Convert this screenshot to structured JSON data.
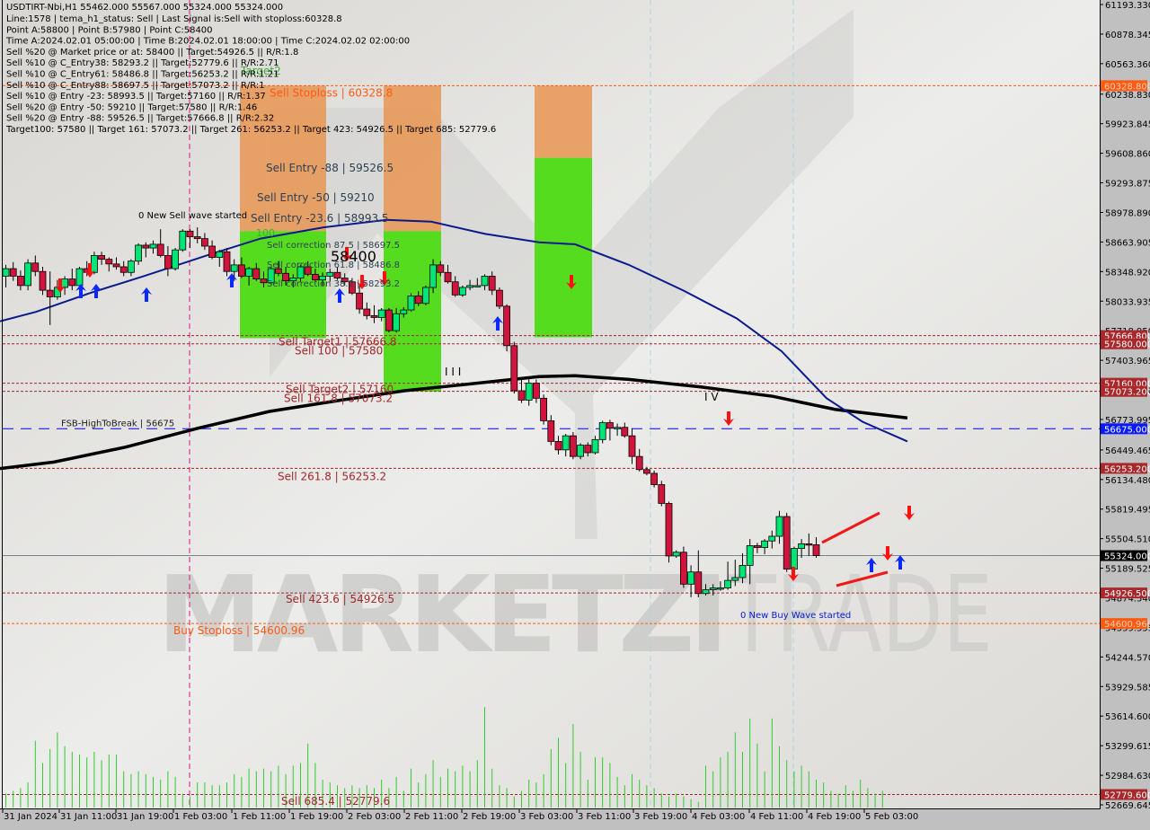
{
  "header": {
    "symbol_line": "USDTIRT-Nbi,H1  55462.000 55567.000 55324.000 55324.000",
    "info_lines": [
      "Line:1578 | tema_h1_status: Sell | Last Signal is:Sell with stoploss:60328.8",
      "Point A:58800 | Point B:57980 | Point C:58400",
      "Time A:2024.02.01 05:00:00 | Time B:2024.02.01 18:00:00 | Time C:2024.02.02 02:00:00",
      "Sell %20 @ Market price or at: 58400 || Target:54926.5 || R/R:1.8",
      "Sell %10 @ C_Entry38: 58293.2 || Target:52779.6 || R/R:2.71",
      "Sell %10 @ C_Entry61: 58486.8 || Target:56253.2 || R/R:1.21",
      "Sell %10 @ C_Entry88: 58697.5 || Target:57073.2 || R/R:1",
      "Sell %10 @ Entry -23: 58993.5 || Target:57160 || R/R:1.37",
      "Sell %20 @ Entry -50: 59210 || Target:57580 || R/R:1.46",
      "Sell %20 @ Entry -88: 59526.5 || Target:57666.8 || R/R:2.32",
      "Target100: 57580 || Target 161: 57073.2 || Target 261: 56253.2 || Target 423: 54926.5 || Target 685: 52779.6"
    ]
  },
  "watermark": {
    "left": "MARKETZI",
    "right": "TRADE"
  },
  "colors": {
    "background": "#e4e4e2",
    "axis_bg": "#c0c0c0",
    "bull": "#00e676",
    "bear": "#d0143c",
    "green_zone": "#56dc1e",
    "orange_zone": "#e89a5a",
    "level_red": "#a0282c",
    "level_orange": "#ff5a14",
    "level_blue": "#0000ff",
    "ma_fast": "#0a1a8c",
    "ma_slow": "#000000",
    "volume": "#2ecc2e"
  },
  "chart_data": {
    "type": "candlestick",
    "title": "USDTIRT-Nbi,H1",
    "ylim": [
      52669.645,
      61193.33
    ],
    "y_ticks": [
      61193.33,
      60878.345,
      60563.36,
      60238.83,
      59923.845,
      59608.86,
      59293.875,
      58978.89,
      58663.905,
      58348.92,
      58033.935,
      57718.95,
      57403.965,
      57088.98,
      56773.995,
      56449.465,
      56134.48,
      55819.495,
      55504.51,
      55189.525,
      54874.54,
      54559.555,
      54244.57,
      53929.585,
      53614.6,
      53299.615,
      52984.63,
      52669.645
    ],
    "x_ticks": [
      "31 Jan 2024",
      "31 Jan 11:00",
      "31 Jan 19:00",
      "1 Feb 03:00",
      "1 Feb 11:00",
      "1 Feb 19:00",
      "2 Feb 03:00",
      "2 Feb 11:00",
      "2 Feb 19:00",
      "3 Feb 03:00",
      "3 Feb 11:00",
      "3 Feb 19:00",
      "4 Feb 03:00",
      "4 Feb 11:00",
      "4 Feb 19:00",
      "5 Feb 03:00"
    ],
    "last_price": 55324.0,
    "price_labels": [
      {
        "value": 60328.8,
        "text": "60328.800",
        "kind": "orange"
      },
      {
        "value": 57666.8,
        "text": "57666.800",
        "kind": "red"
      },
      {
        "value": 57580.0,
        "text": "57580.000",
        "kind": "red"
      },
      {
        "value": 57160.0,
        "text": "57160.000",
        "kind": "red"
      },
      {
        "value": 57073.2,
        "text": "57073.200",
        "kind": "red"
      },
      {
        "value": 56675.0,
        "text": "56675.000",
        "kind": "blue"
      },
      {
        "value": 56253.2,
        "text": "56253.200",
        "kind": "red"
      },
      {
        "value": 55324.0,
        "text": "55324.000",
        "kind": "black"
      },
      {
        "value": 54926.5,
        "text": "54926.500",
        "kind": "red"
      },
      {
        "value": 54600.96,
        "text": "54600.960",
        "kind": "orange"
      },
      {
        "value": 52779.6,
        "text": "52779.600",
        "kind": "red"
      }
    ],
    "levels": [
      {
        "value": 60328.8,
        "label": "Sell Stoploss | 60328.8",
        "kind": "orange"
      },
      {
        "value": 57666.8,
        "label": "Sell Target1 | 57666.8",
        "kind": "red"
      },
      {
        "value": 57580.0,
        "label": "Sell 100 | 57580",
        "kind": "red"
      },
      {
        "value": 57160.0,
        "label": "Sell Target2 | 57160",
        "kind": "red"
      },
      {
        "value": 57073.2,
        "label": "Sell 161.8 | 57073.2",
        "kind": "red"
      },
      {
        "value": 56675.0,
        "label": "FSB-HighToBreak | 56675",
        "kind": "blue"
      },
      {
        "value": 56253.2,
        "label": "Sell  261.8 | 56253.2",
        "kind": "red"
      },
      {
        "value": 54926.5,
        "label": "Sell  423.6 | 54926.5",
        "kind": "red"
      },
      {
        "value": 54600.96,
        "label": "Buy Stoploss | 54600.96",
        "kind": "orange"
      },
      {
        "value": 52779.6,
        "label": "Sell  685.4 | 52779.6",
        "kind": "red"
      }
    ],
    "zone_labels": [
      {
        "value": 59526.5,
        "text": "Sell Entry -88 | 59526.5"
      },
      {
        "value": 59210,
        "text": "Sell Entry -50 | 59210"
      },
      {
        "value": 58993.5,
        "text": "Sell Entry -23.6 | 58993.5"
      },
      {
        "value": 58697.5,
        "text": "Sell correction 87.5 | 58697.5"
      },
      {
        "value": 58486.8,
        "text": "Sell correction 61.8 | 58486.8"
      },
      {
        "value": 58293.2,
        "text": "Sell correction 38.2 | 58293.2"
      }
    ],
    "annotations": [
      {
        "text": "0 New Sell wave started",
        "value": 58900
      },
      {
        "text": "0 New Buy Wave started",
        "value": 54700
      },
      {
        "text": "Target2",
        "value": 60470
      },
      {
        "text": "58400",
        "value": 58430
      },
      {
        "text": "I V",
        "value": 57040
      },
      {
        "text": "I I I",
        "value": 57520
      },
      {
        "text": "100",
        "value": 58780
      }
    ],
    "candles": [
      [
        58300,
        58420,
        58180,
        58380
      ],
      [
        58380,
        58450,
        58250,
        58300
      ],
      [
        58300,
        58360,
        58150,
        58200
      ],
      [
        58200,
        58480,
        58150,
        58440
      ],
      [
        58440,
        58520,
        58300,
        58350
      ],
      [
        58350,
        58400,
        58100,
        58150
      ],
      [
        58150,
        58350,
        57780,
        58080
      ],
      [
        58080,
        58260,
        58050,
        58180
      ],
      [
        58180,
        58300,
        58100,
        58270
      ],
      [
        58270,
        58380,
        58150,
        58200
      ],
      [
        58200,
        58400,
        58180,
        58380
      ],
      [
        58380,
        58460,
        58300,
        58340
      ],
      [
        58340,
        58560,
        58320,
        58520
      ],
      [
        58520,
        58560,
        58420,
        58480
      ],
      [
        58480,
        58500,
        58350,
        58430
      ],
      [
        58430,
        58500,
        58370,
        58400
      ],
      [
        58400,
        58460,
        58300,
        58340
      ],
      [
        58340,
        58480,
        58300,
        58460
      ],
      [
        58460,
        58650,
        58420,
        58630
      ],
      [
        58630,
        58660,
        58500,
        58600
      ],
      [
        58600,
        58680,
        58540,
        58640
      ],
      [
        58640,
        58800,
        58500,
        58520
      ],
      [
        58520,
        58620,
        58300,
        58380
      ],
      [
        58380,
        58600,
        58360,
        58580
      ],
      [
        58580,
        58800,
        58560,
        58780
      ],
      [
        58780,
        58800,
        58600,
        58720
      ],
      [
        58720,
        58820,
        58650,
        58700
      ],
      [
        58700,
        58760,
        58580,
        58620
      ],
      [
        58620,
        58680,
        58480,
        58500
      ],
      [
        58500,
        58580,
        58400,
        58560
      ],
      [
        58560,
        58600,
        58300,
        58350
      ],
      [
        58350,
        58480,
        58250,
        58420
      ],
      [
        58420,
        58500,
        58280,
        58300
      ],
      [
        58300,
        58400,
        58200,
        58380
      ],
      [
        58380,
        58440,
        58250,
        58270
      ],
      [
        58270,
        58350,
        58180,
        58230
      ],
      [
        58230,
        58400,
        58220,
        58380
      ],
      [
        58380,
        58460,
        58300,
        58330
      ],
      [
        58330,
        58400,
        58200,
        58250
      ],
      [
        58250,
        58320,
        58180,
        58280
      ],
      [
        58280,
        58420,
        58240,
        58400
      ],
      [
        58400,
        58460,
        58300,
        58320
      ],
      [
        58320,
        58380,
        58240,
        58260
      ],
      [
        58260,
        58340,
        58200,
        58300
      ],
      [
        58300,
        58380,
        58240,
        58340
      ],
      [
        58340,
        58400,
        58260,
        58280
      ],
      [
        58280,
        58330,
        58200,
        58240
      ],
      [
        58240,
        58280,
        58100,
        58120
      ],
      [
        58120,
        58200,
        57900,
        57950
      ],
      [
        57950,
        58020,
        57840,
        57880
      ],
      [
        57880,
        57990,
        57800,
        57860
      ],
      [
        57860,
        57960,
        57820,
        57940
      ],
      [
        57940,
        57960,
        57700,
        57720
      ],
      [
        57720,
        57960,
        57700,
        57900
      ],
      [
        57900,
        57970,
        57860,
        57940
      ],
      [
        57940,
        58120,
        57920,
        58090
      ],
      [
        58090,
        58140,
        57980,
        58010
      ],
      [
        58010,
        58200,
        57990,
        58180
      ],
      [
        58180,
        58480,
        58120,
        58420
      ],
      [
        58420,
        58460,
        58300,
        58340
      ],
      [
        58340,
        58420,
        58220,
        58240
      ],
      [
        58240,
        58300,
        58080,
        58100
      ],
      [
        58100,
        58200,
        58080,
        58180
      ],
      [
        58180,
        58260,
        58150,
        58200
      ],
      [
        58200,
        58280,
        58180,
        58200
      ],
      [
        58200,
        58320,
        58150,
        58300
      ],
      [
        58300,
        58350,
        58100,
        58150
      ],
      [
        58150,
        58180,
        57950,
        57980
      ],
      [
        57980,
        58000,
        57500,
        57560
      ],
      [
        57560,
        57600,
        57050,
        57080
      ],
      [
        57080,
        57200,
        56950,
        56980
      ],
      [
        56980,
        57200,
        56920,
        57160
      ],
      [
        57160,
        57200,
        56950,
        57000
      ],
      [
        57000,
        57040,
        56720,
        56760
      ],
      [
        56760,
        56820,
        56500,
        56540
      ],
      [
        56540,
        56600,
        56400,
        56450
      ],
      [
        56450,
        56620,
        56380,
        56600
      ],
      [
        56600,
        56640,
        56350,
        56380
      ],
      [
        56380,
        56520,
        56350,
        56500
      ],
      [
        56500,
        56530,
        56380,
        56420
      ],
      [
        56420,
        56600,
        56400,
        56560
      ],
      [
        56560,
        56760,
        56520,
        56740
      ],
      [
        56740,
        56770,
        56550,
        56680
      ],
      [
        56680,
        56730,
        56600,
        56690
      ],
      [
        56690,
        56740,
        56580,
        56600
      ],
      [
        56600,
        56680,
        56300,
        56380
      ],
      [
        56380,
        56460,
        56220,
        56240
      ],
      [
        56240,
        56270,
        56180,
        56200
      ],
      [
        56200,
        56230,
        56050,
        56080
      ],
      [
        56080,
        56120,
        55850,
        55880
      ],
      [
        55880,
        55900,
        55250,
        55320
      ],
      [
        55320,
        55380,
        55300,
        55360
      ],
      [
        55360,
        55420,
        54980,
        55020
      ],
      [
        55020,
        55220,
        54880,
        55150
      ],
      [
        55150,
        55380,
        54880,
        54920
      ],
      [
        54920,
        55020,
        54900,
        54960
      ],
      [
        54960,
        55020,
        54900,
        54980
      ],
      [
        54980,
        55050,
        54950,
        54980
      ],
      [
        54980,
        55260,
        54960,
        55060
      ],
      [
        55060,
        55280,
        55000,
        55090
      ],
      [
        55090,
        55350,
        55030,
        55220
      ],
      [
        55220,
        55500,
        55020,
        55430
      ],
      [
        55430,
        55460,
        55350,
        55410
      ],
      [
        55410,
        55500,
        55340,
        55480
      ],
      [
        55480,
        55590,
        55400,
        55530
      ],
      [
        55530,
        55800,
        55450,
        55740
      ],
      [
        55740,
        55780,
        55150,
        55180
      ],
      [
        55180,
        55420,
        55130,
        55400
      ],
      [
        55400,
        55500,
        55300,
        55450
      ],
      [
        55450,
        55560,
        55320,
        55440
      ],
      [
        55440,
        55520,
        55300,
        55324
      ]
    ],
    "volume": [
      5,
      6,
      7,
      9,
      24,
      16,
      21,
      27,
      22,
      20,
      19,
      18,
      20,
      17,
      19,
      19,
      13,
      12,
      13,
      12,
      11,
      10,
      13,
      11,
      5,
      4,
      9,
      9,
      8,
      8,
      9,
      12,
      11,
      14,
      13,
      14,
      13,
      15,
      12,
      15,
      16,
      23,
      16,
      10,
      9,
      8,
      7,
      8,
      7,
      8,
      7,
      10,
      7,
      11,
      6,
      14,
      9,
      12,
      17,
      11,
      14,
      13,
      15,
      13,
      17,
      36,
      14,
      8,
      7,
      4,
      6,
      10,
      9,
      12,
      21,
      25,
      16,
      30,
      20,
      10,
      18,
      18,
      16,
      11,
      8,
      12,
      10,
      8,
      7,
      5,
      4,
      5,
      4,
      3,
      2,
      15,
      13,
      18,
      20,
      27,
      20,
      32,
      23,
      13,
      32,
      22,
      17,
      13,
      15,
      13,
      10,
      9,
      6,
      5,
      8,
      6,
      10,
      7,
      5,
      6
    ],
    "ma_fast": [
      [
        0,
        57820
      ],
      [
        40,
        57920
      ],
      [
        100,
        58120
      ],
      [
        160,
        58300
      ],
      [
        230,
        58520
      ],
      [
        290,
        58700
      ],
      [
        360,
        58820
      ],
      [
        430,
        58900
      ],
      [
        480,
        58880
      ],
      [
        540,
        58750
      ],
      [
        600,
        58660
      ],
      [
        640,
        58640
      ],
      [
        700,
        58420
      ],
      [
        760,
        58150
      ],
      [
        820,
        57850
      ],
      [
        870,
        57500
      ],
      [
        920,
        57000
      ],
      [
        960,
        56750
      ],
      [
        1010,
        56540
      ]
    ],
    "ma_slow": [
      [
        0,
        56250
      ],
      [
        60,
        56320
      ],
      [
        140,
        56480
      ],
      [
        220,
        56680
      ],
      [
        300,
        56860
      ],
      [
        380,
        56980
      ],
      [
        450,
        57080
      ],
      [
        520,
        57150
      ],
      [
        600,
        57230
      ],
      [
        640,
        57240
      ],
      [
        700,
        57200
      ],
      [
        780,
        57120
      ],
      [
        860,
        57020
      ],
      [
        930,
        56880
      ],
      [
        1010,
        56790
      ]
    ]
  }
}
